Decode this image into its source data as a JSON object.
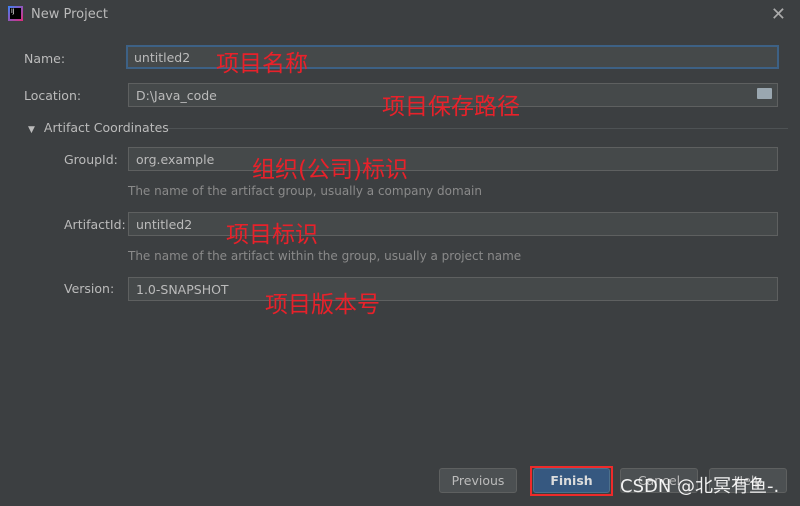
{
  "window": {
    "title": "New Project",
    "icon": "intellij-icon",
    "close_icon": "close-icon"
  },
  "form": {
    "name": {
      "label": "Name:",
      "value": "untitled2",
      "annotation": "项目名称"
    },
    "location": {
      "label": "Location:",
      "value": "D:\\Java_code",
      "annotation": "项目保存路径",
      "browse_icon": "folder-icon"
    },
    "section": {
      "label": "Artifact Coordinates",
      "icon": "triangle-down-icon",
      "expanded": true
    },
    "group_id": {
      "label": "GroupId:",
      "value": "org.example",
      "hint": "The name of the artifact group, usually a company domain",
      "annotation": "组织(公司)标识"
    },
    "artifact_id": {
      "label": "ArtifactId:",
      "value": "untitled2",
      "hint": "The name of the artifact within the group, usually a project name",
      "annotation": "项目标识"
    },
    "version": {
      "label": "Version:",
      "value": "1.0-SNAPSHOT",
      "annotation": "项目版本号"
    }
  },
  "buttons": {
    "previous": "Previous",
    "finish": "Finish",
    "cancel": "Cancel",
    "help": "Help"
  },
  "watermark": "CSDN @北冥有鱼-.",
  "colors": {
    "background": "#3c3f41",
    "primary_button": "#365880",
    "annotation": "#e8212a",
    "highlight_box": "#ee2a2a"
  }
}
